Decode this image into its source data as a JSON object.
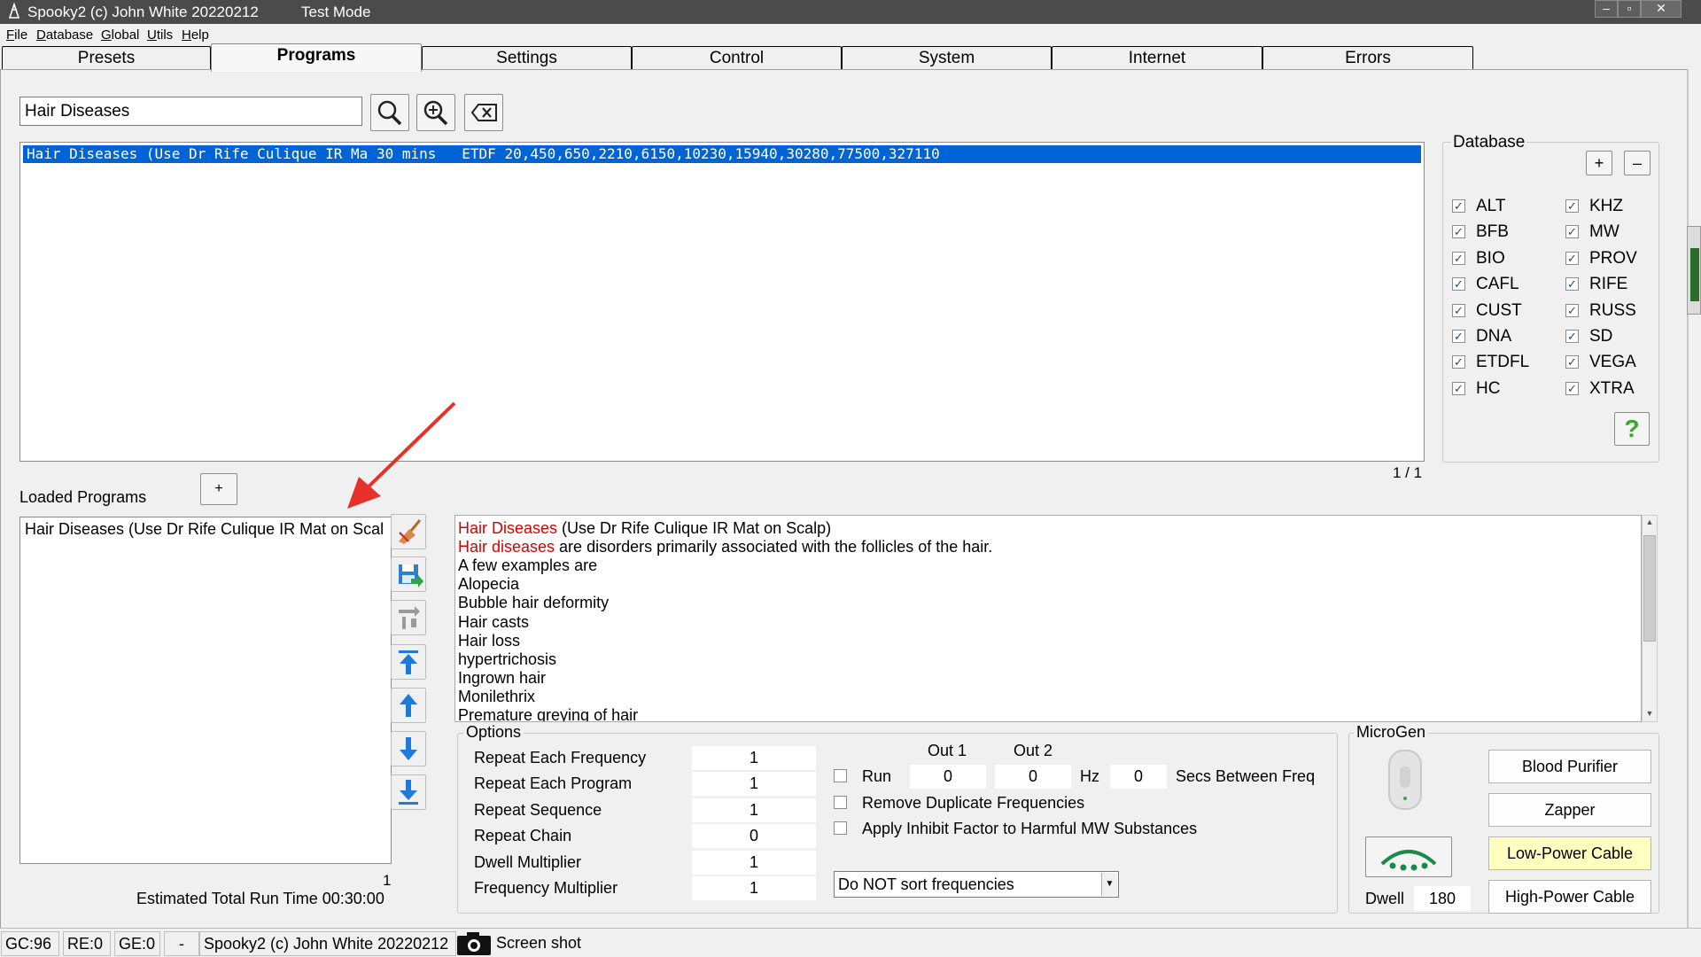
{
  "window": {
    "title": "Spooky2 (c) John White 20220212",
    "mode": "Test Mode",
    "controls": [
      "–",
      "▫",
      "✕"
    ]
  },
  "menu": [
    "File",
    "Database",
    "Global",
    "Utils",
    "Help"
  ],
  "tabs": [
    "Presets",
    "Programs",
    "Settings",
    "Control",
    "System",
    "Internet",
    "Errors"
  ],
  "search": {
    "value": "Hair Diseases"
  },
  "program_list": {
    "selected_row": "Hair Diseases (Use Dr Rife Culique IR Ma 30 mins   ETDF 20,450,650,2210,6150,10230,15940,30280,77500,327110",
    "pager": "1 / 1"
  },
  "database": {
    "title": "Database",
    "add_label": "+",
    "remove_label": "–",
    "help_label": "?",
    "left": [
      "ALT",
      "BFB",
      "BIO",
      "CAFL",
      "CUST",
      "DNA",
      "ETDFL",
      "HC"
    ],
    "right": [
      "KHZ",
      "MW",
      "PROV",
      "RIFE",
      "RUSS",
      "SD",
      "VEGA",
      "XTRA"
    ],
    "check_mark": "✓"
  },
  "loaded": {
    "title": "Loaded Programs",
    "add_label": "+",
    "items": [
      "Hair Diseases (Use Dr Rife Culique IR Mat on Scal"
    ],
    "count": "1",
    "estimated": "Estimated Total Run Time 00:30:00"
  },
  "description": {
    "line1_red": "Hair Diseases",
    "line1_rest": " (Use Dr Rife Culique IR Mat on Scalp)",
    "line2_red": "Hair diseases",
    "line2_rest": " are disorders primarily associated with the follicles of the hair.",
    "lines": [
      "A few examples are",
      "Alopecia",
      "Bubble hair deformity",
      "Hair casts",
      "Hair loss",
      "hypertrichosis",
      "Ingrown hair",
      "Monilethrix",
      "Premature greying of hair"
    ]
  },
  "options": {
    "title": "Options",
    "rows": [
      {
        "label": "Repeat Each Frequency",
        "value": "1"
      },
      {
        "label": "Repeat Each Program",
        "value": "1"
      },
      {
        "label": "Repeat Sequence",
        "value": "1"
      },
      {
        "label": "Repeat Chain",
        "value": "0"
      },
      {
        "label": "Dwell Multiplier",
        "value": "1"
      },
      {
        "label": "Frequency Multiplier",
        "value": "1"
      }
    ],
    "out1": "Out 1",
    "out2": "Out 2",
    "run_label": "Run",
    "run_out1": "0",
    "run_out2": "0",
    "hz": "Hz",
    "secs_value": "0",
    "secs_label": "Secs Between Freq",
    "remove_dup": "Remove Duplicate Frequencies",
    "apply_inhibit": "Apply Inhibit Factor to Harmful MW Substances",
    "sort_select": "Do NOT sort frequencies"
  },
  "microgen": {
    "title": "MicroGen",
    "buttons": [
      "Blood Purifier",
      "Zapper",
      "Low-Power Cable",
      "High-Power Cable"
    ],
    "dwell_label": "Dwell",
    "dwell_value": "180",
    "highlight_color": "#ffffc0"
  },
  "status": {
    "gc": "GC:96",
    "re": "RE:0",
    "ge": "GE:0",
    "dash": "-",
    "title": "Spooky2 (c) John White 20220212",
    "screenshot": "Screen shot"
  },
  "colors": {
    "selection": "#0064d7",
    "arrow": "#e8302a",
    "accent_icon": "#1f7ad9"
  }
}
